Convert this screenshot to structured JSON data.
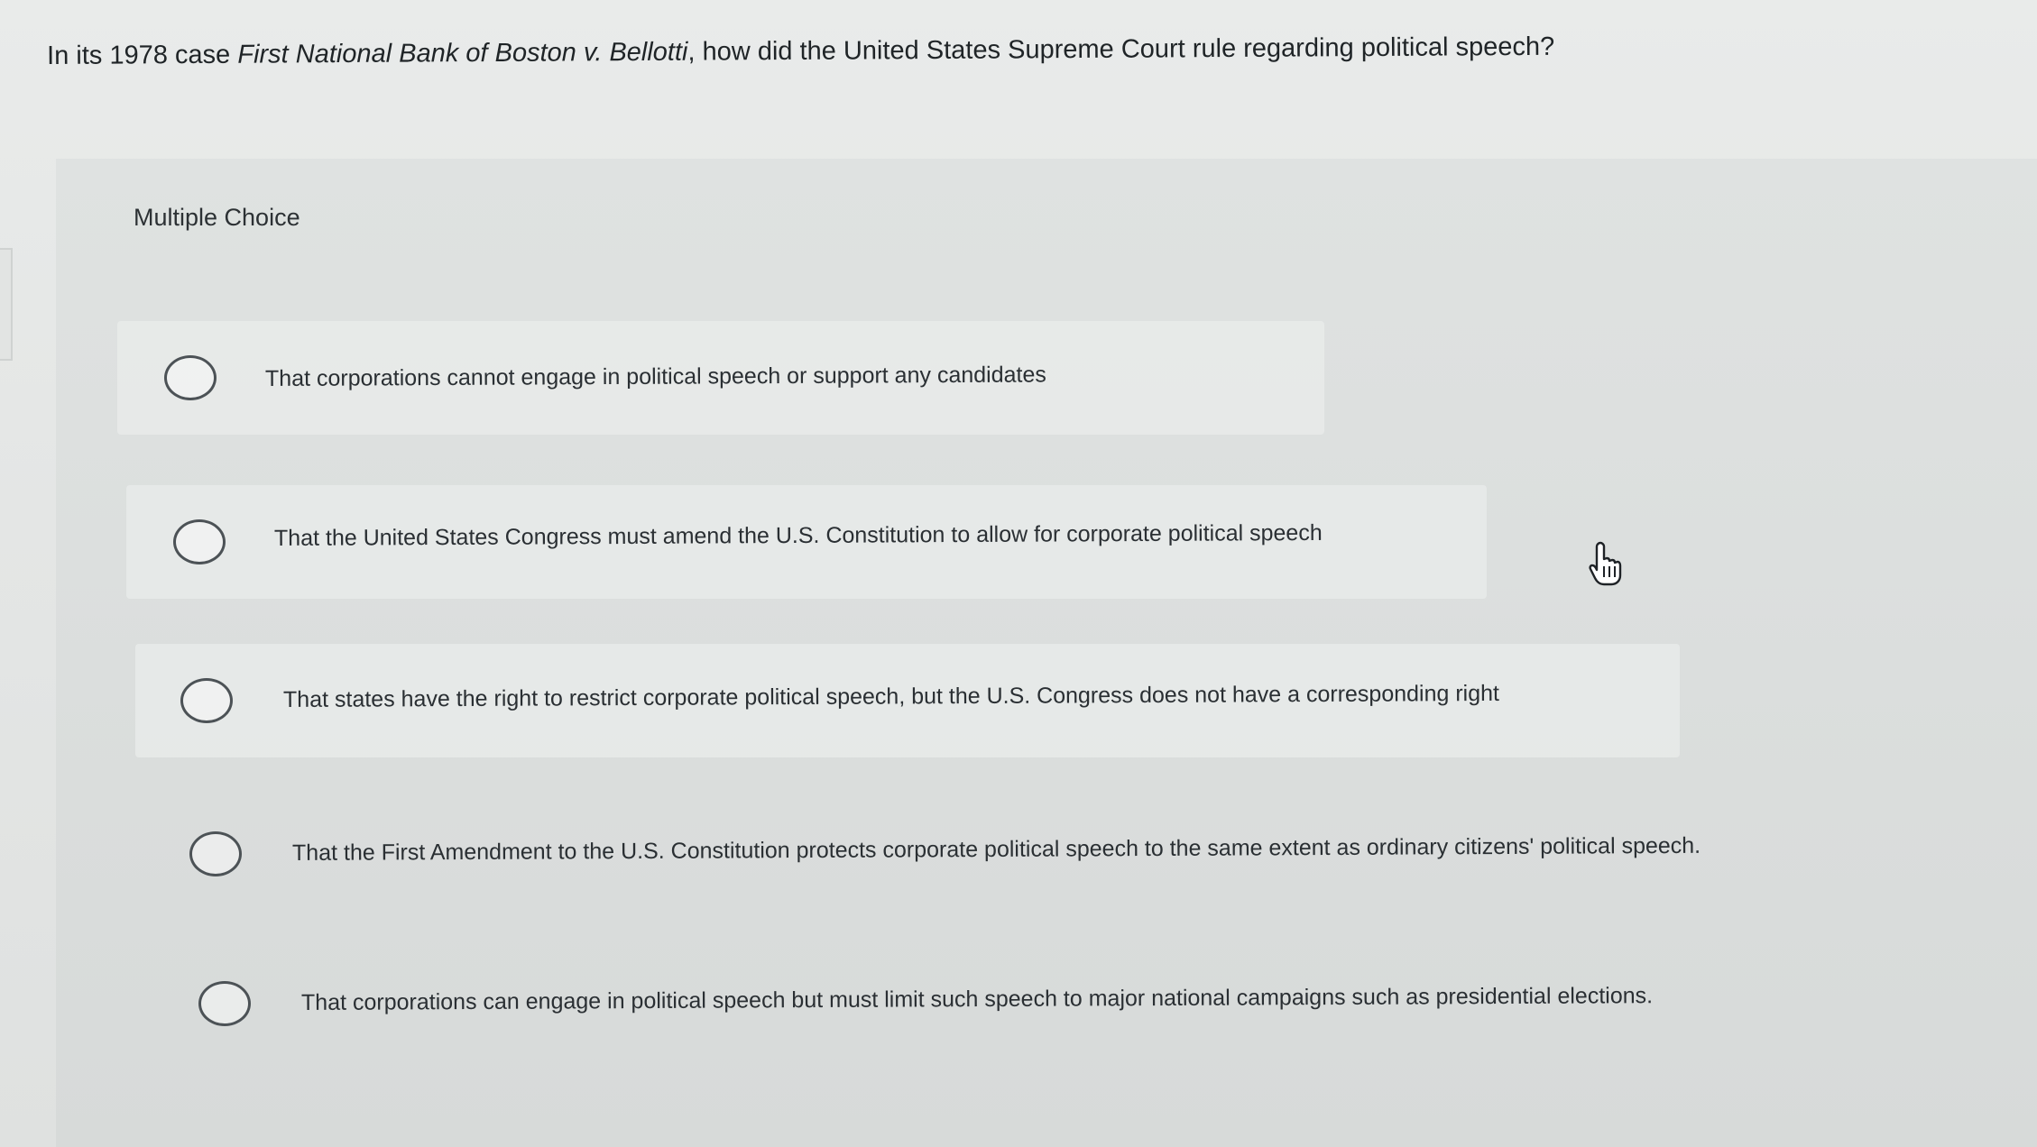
{
  "question": {
    "prefix": "In its 1978 case ",
    "case_name": "First National Bank of Boston v. Bellotti",
    "suffix": ", how did the United States Supreme Court rule regarding political speech?"
  },
  "panel": {
    "label": "Multiple Choice"
  },
  "options": [
    {
      "text": "That corporations cannot engage in political speech or support any candidates"
    },
    {
      "text": "That the United States Congress must amend the U.S. Constitution to allow for corporate political speech"
    },
    {
      "text": "That states have the right to restrict corporate political speech, but the U.S. Congress does not have a corresponding right"
    },
    {
      "text": "That the First Amendment to the U.S. Constitution protects corporate political speech to the same extent as ordinary citizens' political speech."
    },
    {
      "text": "That corporations can engage in political speech but must limit such speech to major national campaigns such as presidential elections."
    }
  ],
  "cursor_icon": "hand-pointer-icon"
}
